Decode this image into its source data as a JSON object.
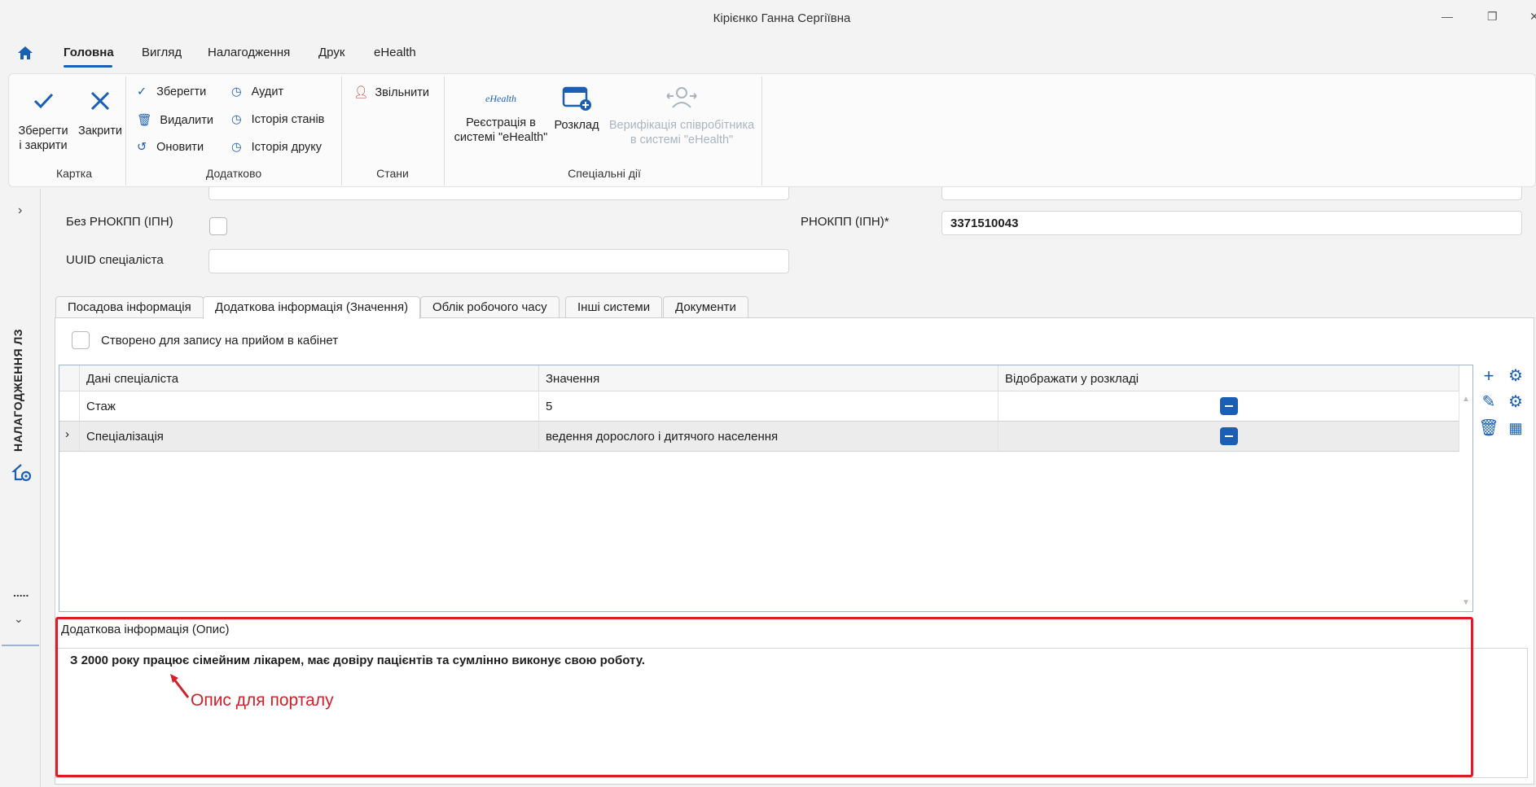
{
  "window": {
    "title": "Кірієнко Ганна Сергіївна",
    "minimize": "—",
    "restore": "❐",
    "close": "✕"
  },
  "menu": {
    "items": [
      "Головна",
      "Вигляд",
      "Налагодження",
      "Друк",
      "eHealth"
    ]
  },
  "ribbon": {
    "save_close": "Зберегти і закрити",
    "close": "Закрити",
    "group_card": "Картка",
    "save": "Зберегти",
    "delete": "Видалити",
    "refresh": "Оновити",
    "audit": "Аудит",
    "state_history": "Історія станів",
    "print_history": "Історія друку",
    "group_extra": "Додатково",
    "dismiss": "Звільнити",
    "group_states": "Стани",
    "ehealth_logo": "eHealth",
    "ehealth_register": "Реєстрація в системі \"eHealth\"",
    "schedule": "Розклад",
    "verify": "Верифікація співробітника в системі \"eHealth\"",
    "group_special": "Спеціальні дії"
  },
  "sidebar": {
    "vertical_label": "НАЛАГОДЖЕННЯ ЛЗ",
    "dots": "....."
  },
  "form": {
    "no_rnokpp_label": "Без РНОКПП (ІПН)",
    "rnokpp_label": "РНОКПП (ІПН)*",
    "rnokpp_value": "3371510043",
    "uuid_label": "UUID спеціаліста",
    "uuid_value": ""
  },
  "tabs": [
    "Посадова інформація",
    "Додаткова інформація (Значення)",
    "Облік робочого часу",
    "Інші системи",
    "Документи"
  ],
  "active_tab": 1,
  "created_for_cabinet": "Створено для запису на прийом в кабінет",
  "grid": {
    "columns": [
      "Дані спеціаліста",
      "Значення",
      "Відображати у розкладі"
    ],
    "rows": [
      {
        "name": "Стаж",
        "value": "5"
      },
      {
        "name": "Спеціалізація",
        "value": "ведення дорослого і дитячого населення"
      }
    ]
  },
  "description": {
    "label": "Додаткова інформація (Опис)",
    "text": "З 2000 року працює сімейним лікарем, має довіру пацієнтів та сумлінно виконує свою роботу."
  },
  "annotation": "Опис для порталу",
  "accent_color": "#1a5fb4",
  "highlight_color": "#e11b22"
}
